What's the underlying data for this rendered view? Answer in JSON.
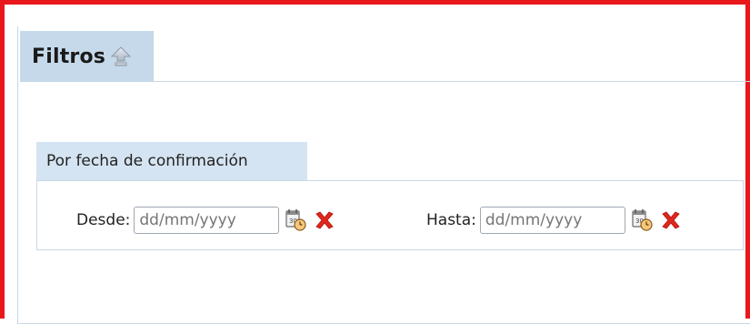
{
  "filters": {
    "title": "Filtros",
    "collapse_icon": "collapse-up-arrow-icon"
  },
  "date_section": {
    "title": "Por fecha de confirmación",
    "from": {
      "label": "Desde:",
      "placeholder": "dd/mm/yyyy",
      "calendar_icon": "calendar-clock-icon",
      "clear_icon": "clear-x-icon"
    },
    "to": {
      "label": "Hasta:",
      "placeholder": "dd/mm/yyyy",
      "calendar_icon": "calendar-clock-icon",
      "clear_icon": "clear-x-icon"
    }
  },
  "colors": {
    "frame_border": "#e8171b",
    "tab_background": "#c5d9ea",
    "section_tab_background": "#d5e4f2",
    "border": "#c8d7e6",
    "clear_icon": "#e2261b"
  }
}
